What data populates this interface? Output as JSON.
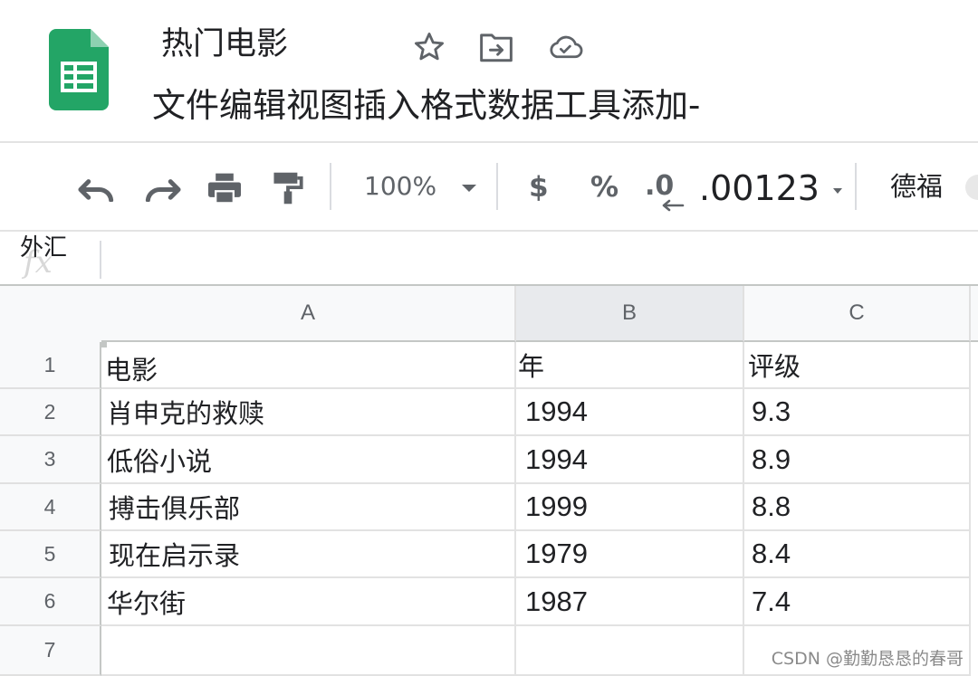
{
  "app": {
    "logo_icon": "google-sheets-icon",
    "title": "热门电影",
    "title_icons": [
      "star-icon",
      "move-to-folder-icon",
      "cloud-saved-icon"
    ]
  },
  "menu": {
    "items": [
      "文件",
      "编辑",
      "视图",
      "插入",
      "格式",
      "数据",
      "工具",
      "添加-"
    ]
  },
  "toolbar": {
    "icons": [
      "undo-icon",
      "redo-icon",
      "print-icon",
      "paint-format-icon"
    ],
    "zoom": "100%",
    "currency": "$",
    "percent": "%",
    "decrease_decimal": ".0",
    "more_formats": ".00123",
    "font": "德福"
  },
  "formula_bar": {
    "fx_icon": "fx-icon",
    "cell_ref": "外汇",
    "value": ""
  },
  "sheet": {
    "columns": [
      "A",
      "B",
      "C"
    ],
    "selected_column": "B",
    "row_numbers": [
      "1",
      "2",
      "3",
      "4",
      "5",
      "6",
      "7"
    ],
    "rows": [
      [
        "电影",
        "年",
        "评级"
      ],
      [
        "肖申克的救赎",
        "1994",
        "9.3"
      ],
      [
        "低俗小说",
        "1994",
        "8.9"
      ],
      [
        "搏击俱乐部",
        "1999",
        "8.8"
      ],
      [
        "现在启示录",
        "1979",
        "8.4"
      ],
      [
        "华尔街",
        "1987",
        "7.4"
      ],
      [
        "",
        "",
        ""
      ]
    ]
  },
  "watermark": "CSDN @勤勤恳恳的春哥",
  "colors": {
    "sheets_green": "#23a566",
    "toolbar_icon": "#5f6368",
    "header_bg": "#f8f9fa"
  }
}
